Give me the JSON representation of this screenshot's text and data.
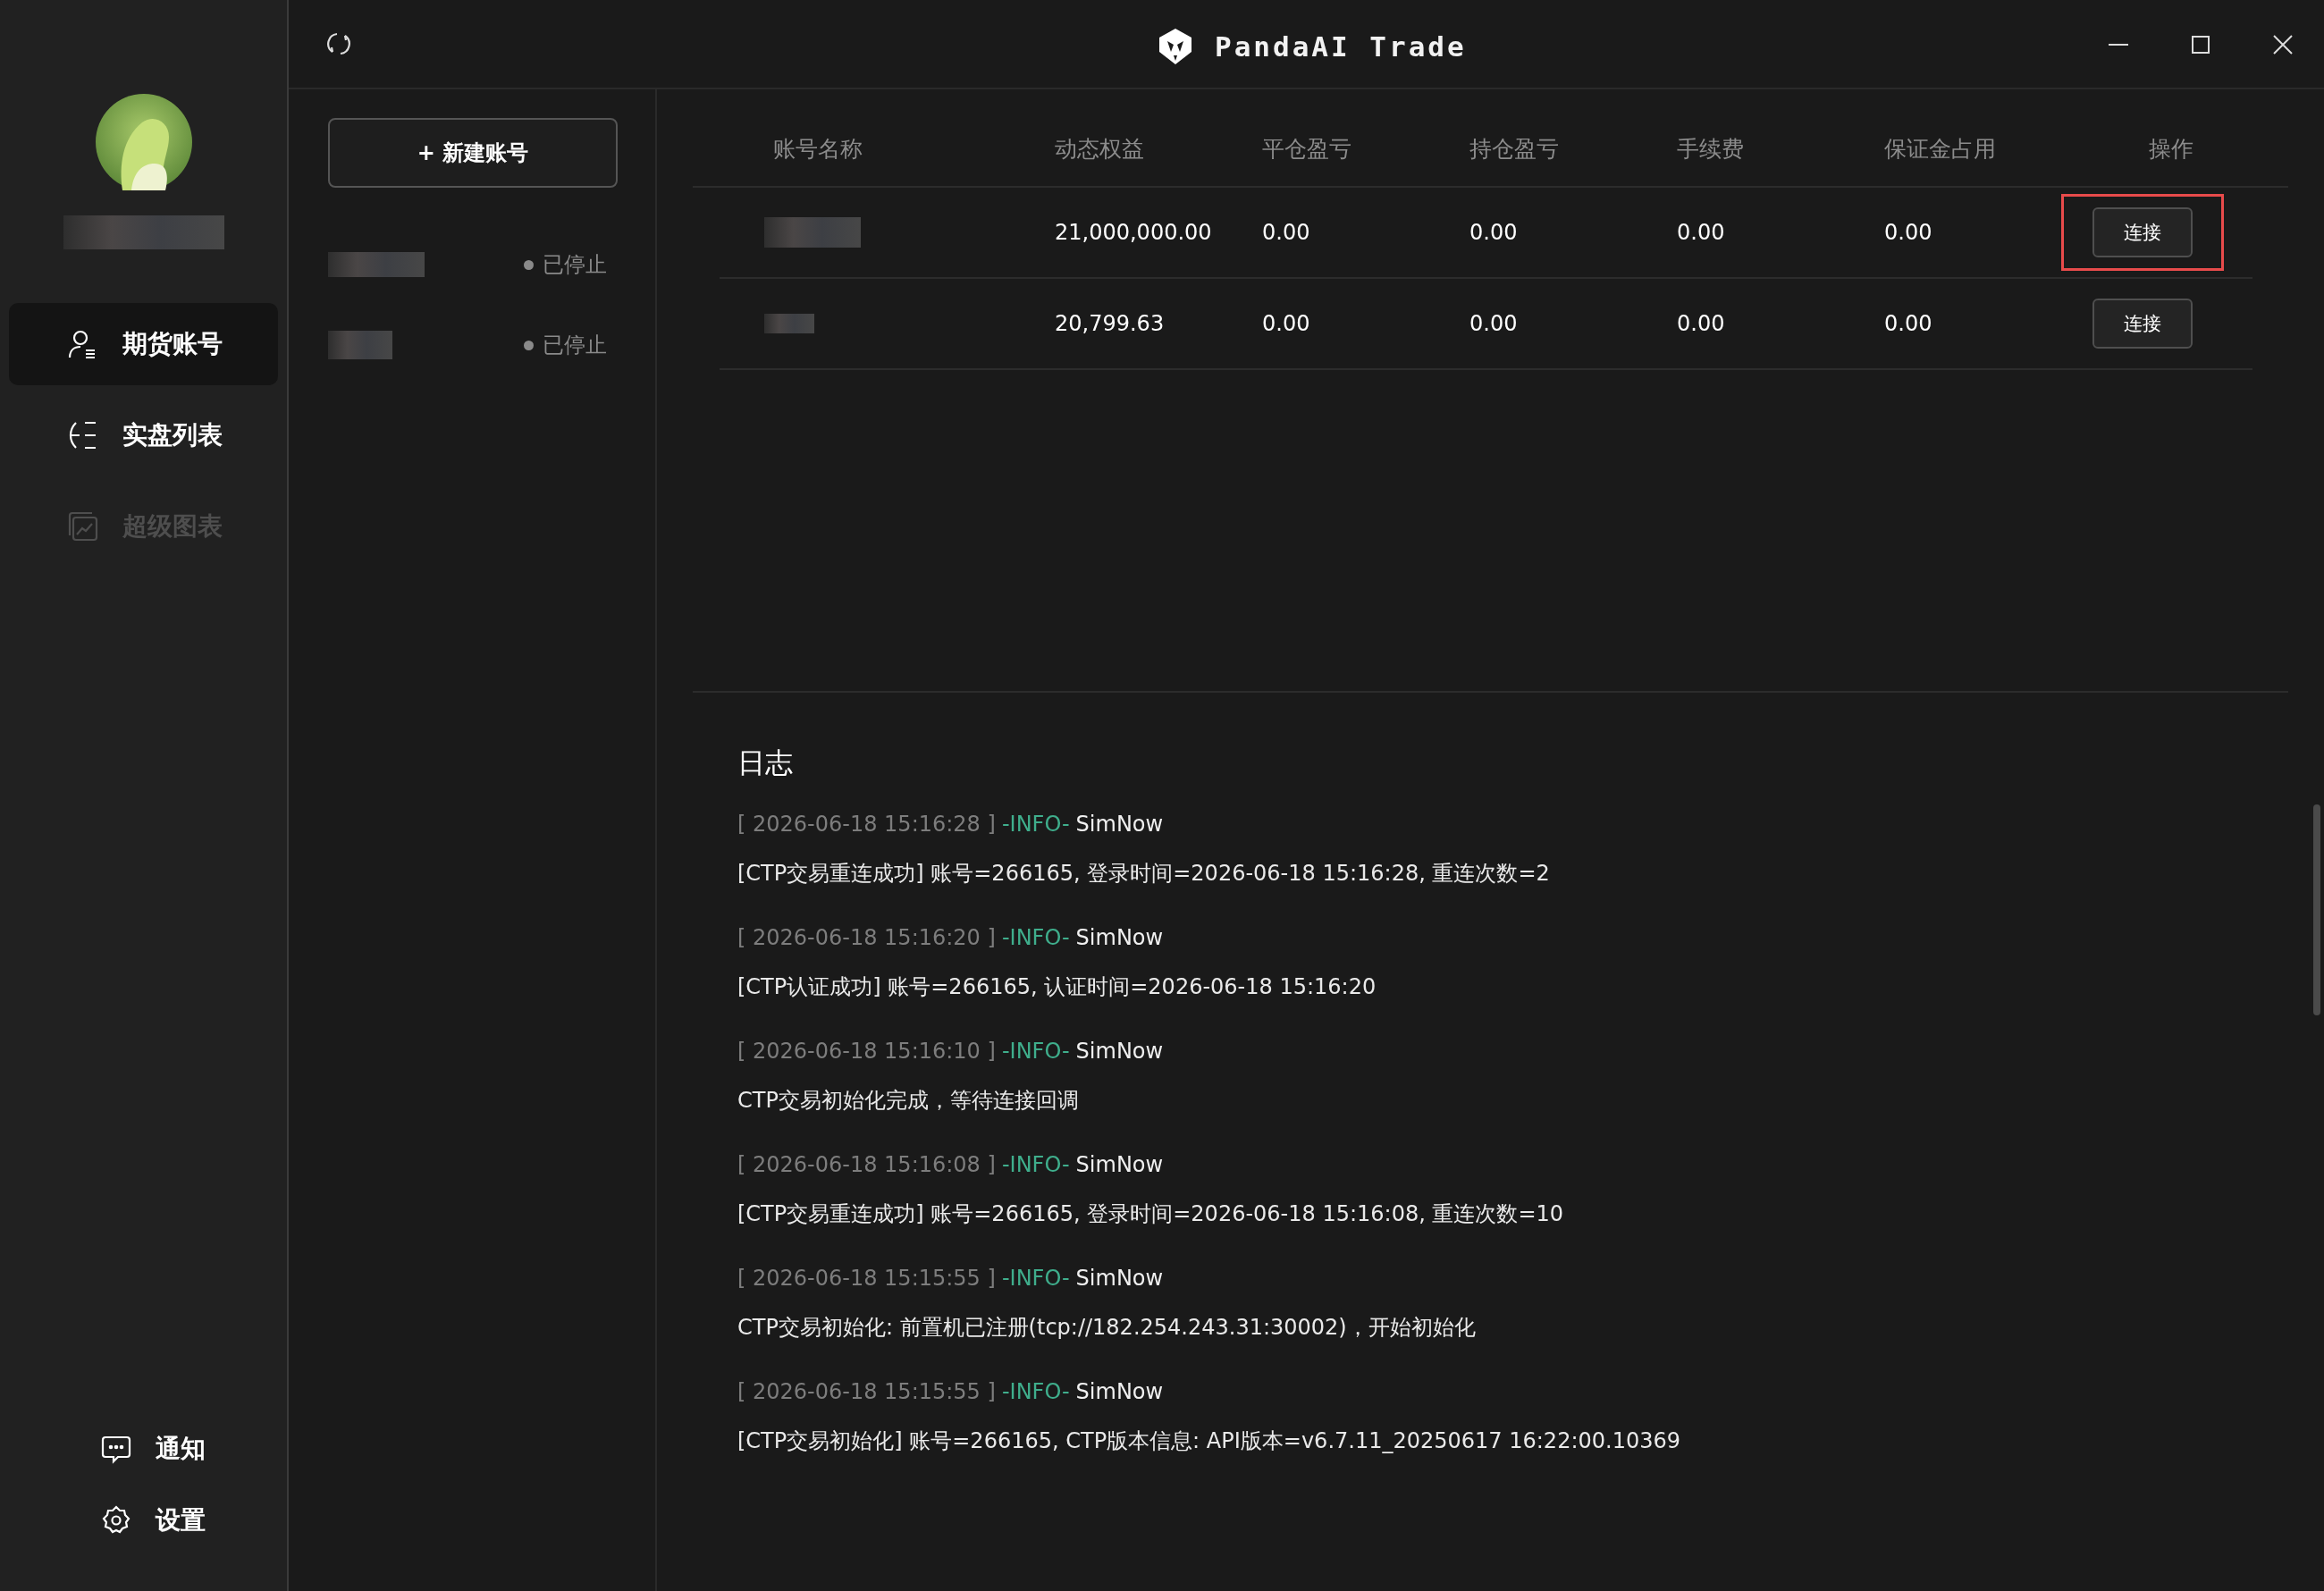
{
  "window": {
    "title": "PandaAI Trade"
  },
  "sidebar": {
    "nav": [
      {
        "label": "期货账号",
        "kind": "user",
        "selected": true,
        "disabled": false
      },
      {
        "label": "实盘列表",
        "kind": "list",
        "selected": false,
        "disabled": false
      },
      {
        "label": "超级图表",
        "kind": "chart",
        "selected": false,
        "disabled": true
      }
    ],
    "bottom": [
      {
        "label": "通知",
        "kind": "chat"
      },
      {
        "label": "设置",
        "kind": "gear"
      }
    ]
  },
  "accounts": {
    "new_button": "+ 新建账号",
    "items": [
      {
        "status": "已停止",
        "running": false
      },
      {
        "status": "已停止",
        "running": false
      }
    ]
  },
  "table": {
    "columns": [
      "账号名称",
      "动态权益",
      "平仓盈亏",
      "持仓盈亏",
      "手续费",
      "保证金占用",
      "操作"
    ],
    "rows": [
      {
        "cells": [
          "",
          "21,000,000.00",
          "0.00",
          "0.00",
          "0.00",
          "0.00"
        ],
        "action": "连接",
        "highlighted": true
      },
      {
        "cells": [
          "",
          "20,799.63",
          "0.00",
          "0.00",
          "0.00",
          "0.00"
        ],
        "action": "连接",
        "highlighted": false
      }
    ]
  },
  "log": {
    "title": "日志",
    "entries": [
      {
        "time": "[ 2026-06-18 15:16:28 ]",
        "level": "-INFO-",
        "source": "SimNow",
        "message": "[CTP交易重连成功] 账号=266165, 登录时间=2026-06-18 15:16:28, 重连次数=2"
      },
      {
        "time": "[ 2026-06-18 15:16:20 ]",
        "level": "-INFO-",
        "source": "SimNow",
        "message": "[CTP认证成功] 账号=266165, 认证时间=2026-06-18 15:16:20"
      },
      {
        "time": "[ 2026-06-18 15:16:10 ]",
        "level": "-INFO-",
        "source": "SimNow",
        "message": "CTP交易初始化完成，等待连接回调"
      },
      {
        "time": "[ 2026-06-18 15:16:08 ]",
        "level": "-INFO-",
        "source": "SimNow",
        "message": "[CTP交易重连成功] 账号=266165, 登录时间=2026-06-18 15:16:08, 重连次数=10"
      },
      {
        "time": "[ 2026-06-18 15:15:55 ]",
        "level": "-INFO-",
        "source": "SimNow",
        "message": "CTP交易初始化: 前置机已注册(tcp://182.254.243.31:30002)，开始初始化"
      },
      {
        "time": "[ 2026-06-18 15:15:55 ]",
        "level": "-INFO-",
        "source": "SimNow",
        "message": "[CTP交易初始化] 账号=266165, CTP版本信息: API版本=v6.7.11_20250617 16:22:00.10369"
      }
    ]
  }
}
